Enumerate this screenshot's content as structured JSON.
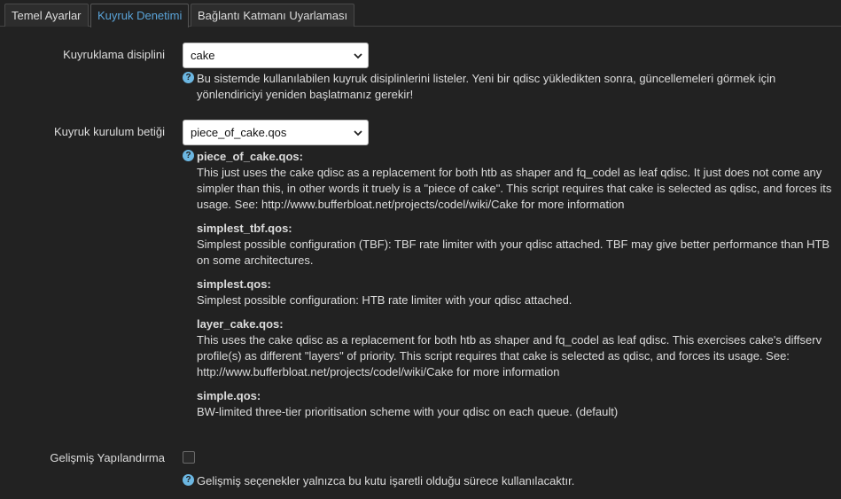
{
  "tabs": [
    {
      "label": "Temel Ayarlar",
      "active": false
    },
    {
      "label": "Kuyruk Denetimi",
      "active": true
    },
    {
      "label": "Bağlantı Katmanı Uyarlaması",
      "active": false
    }
  ],
  "qdisc": {
    "label": "Kuyruklama disiplini",
    "value": "cake",
    "help": "Bu sistemde kullanılabilen kuyruk disiplinlerini listeler. Yeni bir qdisc yükledikten sonra, güncellemeleri görmek için yönlendiriciyi yeniden başlatmanız gerekir!"
  },
  "script": {
    "label": "Kuyruk kurulum betiği",
    "value": "piece_of_cake.qos",
    "entries": [
      {
        "title": "piece_of_cake.qos:",
        "text": "This just uses the cake qdisc as a replacement for both htb as shaper and fq_codel as leaf qdisc. It just does not come any simpler than this, in other words it truely is a \"piece of cake\". This script requires that cake is selected as qdisc, and forces its usage. See: http://www.bufferbloat.net/projects/codel/wiki/Cake for more information"
      },
      {
        "title": "simplest_tbf.qos:",
        "text": "Simplest possible configuration (TBF): TBF rate limiter with your qdisc attached. TBF may give better performance than HTB on some architectures."
      },
      {
        "title": "simplest.qos:",
        "text": "Simplest possible configuration: HTB rate limiter with your qdisc attached."
      },
      {
        "title": "layer_cake.qos:",
        "text": "This uses the cake qdisc as a replacement for both htb as shaper and fq_codel as leaf qdisc. This exercises cake's diffserv profile(s) as different \"layers\" of priority. This script requires that cake is selected as qdisc, and forces its usage. See: http://www.bufferbloat.net/projects/codel/wiki/Cake for more information"
      },
      {
        "title": "simple.qos:",
        "text": "BW-limited three-tier prioritisation scheme with your qdisc on each queue. (default)"
      }
    ]
  },
  "advanced": {
    "label": "Gelişmiş Yapılandırma",
    "checked": false,
    "help": "Gelişmiş seçenekler yalnızca bu kutu işaretli olduğu sürece kullanılacaktır."
  },
  "colors": {
    "background": "#222222",
    "active_tab": "#5aa3d8",
    "help_icon": "#6cb7e2"
  }
}
